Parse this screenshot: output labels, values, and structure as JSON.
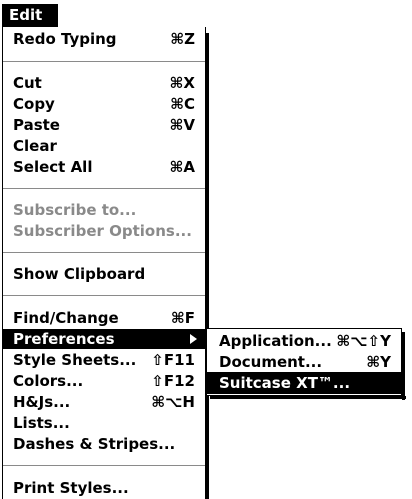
{
  "menu_title": "Edit",
  "items": [
    {
      "label": "Redo Typing",
      "shortcut": "⌘Z"
    },
    {
      "label": "Cut",
      "shortcut": "⌘X"
    },
    {
      "label": "Copy",
      "shortcut": "⌘C"
    },
    {
      "label": "Paste",
      "shortcut": "⌘V"
    },
    {
      "label": "Clear",
      "shortcut": ""
    },
    {
      "label": "Select All",
      "shortcut": "⌘A"
    },
    {
      "label": "Subscribe to...",
      "shortcut": "",
      "disabled": true
    },
    {
      "label": "Subscriber Options...",
      "shortcut": "",
      "disabled": true
    },
    {
      "label": "Show Clipboard",
      "shortcut": ""
    },
    {
      "label": "Find/Change",
      "shortcut": "⌘F"
    },
    {
      "label": "Preferences",
      "shortcut": "",
      "selected": true
    },
    {
      "label": "Style Sheets...",
      "shortcut": "⇧F11"
    },
    {
      "label": "Colors...",
      "shortcut": "⇧F12"
    },
    {
      "label": "H&Js...",
      "shortcut": "⌘⌥H"
    },
    {
      "label": "Lists...",
      "shortcut": ""
    },
    {
      "label": "Dashes & Stripes...",
      "shortcut": ""
    },
    {
      "label": "Print Styles...",
      "shortcut": ""
    }
  ],
  "submenu": [
    {
      "label": "Application...",
      "shortcut": "⌘⌥⇧Y"
    },
    {
      "label": "Document...",
      "shortcut": "⌘Y"
    },
    {
      "label": "Suitcase XT™...",
      "shortcut": "",
      "selected": true
    }
  ],
  "colors": {
    "highlight": "#000000",
    "disabled": "#8a8a8a",
    "background": "#ffffff"
  }
}
